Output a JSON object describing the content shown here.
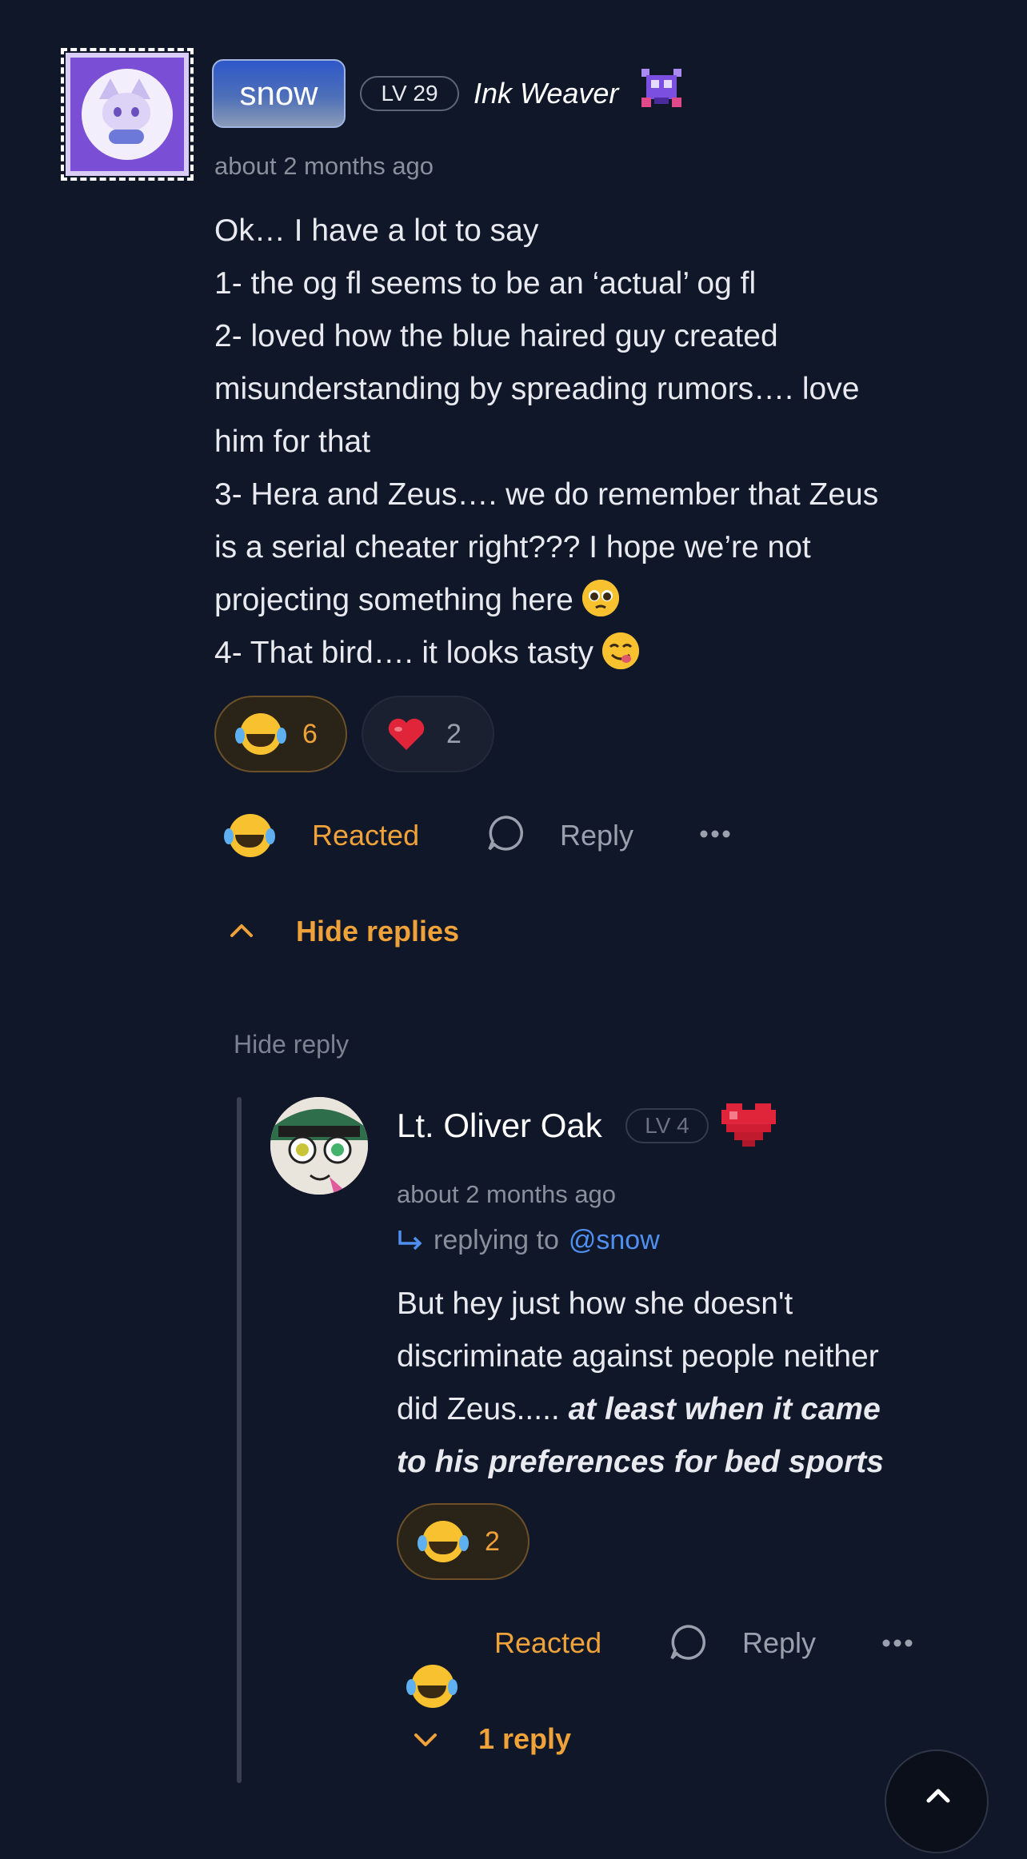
{
  "comment": {
    "username": "snow",
    "level": "LV 29",
    "title": "Ink Weaver",
    "timestamp": "about 2 months ago",
    "lines": [
      "Ok… I have a lot to say",
      "1- the og fl seems to be an ‘actual’ og fl",
      "2- loved how the blue haired guy created",
      "misunderstanding by spreading rumors…. love",
      "him for that",
      "3- Hera and Zeus…. we do remember that Zeus",
      "is a serial cheater right??? I hope we’re not",
      "projecting something here",
      "4- That bird…. it looks tasty"
    ],
    "reactions": [
      {
        "emoji": "laughing-tears",
        "count": "6",
        "active": true
      },
      {
        "emoji": "red-heart",
        "count": "2",
        "active": false
      }
    ],
    "reacted_label": "Reacted",
    "reply_label": "Reply",
    "hide_replies_label": "Hide replies"
  },
  "hide_reply_label": "Hide reply",
  "reply": {
    "username": "Lt. Oliver Oak",
    "level": "LV 4",
    "timestamp": "about 2 months ago",
    "replying_prefix": "replying to",
    "replying_to": "@snow",
    "text_plain": "But hey just how she doesn't discriminate against people neither did Zeus..... ",
    "text_emphasis": "at least when it came to his preferences for bed sports",
    "line1": "But hey just how she doesn't",
    "line2": "discriminate against people neither",
    "line3_plain": "did Zeus..... ",
    "line3_emph": "at least when it came",
    "line4_emph": "to his preferences for bed sports",
    "reaction": {
      "emoji": "laughing-tears",
      "count": "2",
      "active": true
    },
    "reacted_label": "Reacted",
    "reply_label": "Reply",
    "more_replies_label": "1 reply"
  },
  "colors": {
    "background": "#101729",
    "accent_orange": "#f0a23a",
    "mention_blue": "#4f8ff0",
    "muted": "#8a8f9c"
  }
}
